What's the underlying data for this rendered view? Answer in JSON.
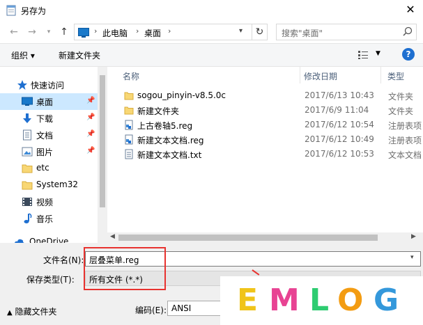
{
  "window": {
    "title": "另存为",
    "close_glyph": "✕"
  },
  "address": {
    "crumbs": [
      "此电脑",
      "桌面"
    ],
    "separator": "›"
  },
  "search": {
    "placeholder": "搜索\"桌面\""
  },
  "toolbar": {
    "organize_label": "组织 ▾",
    "new_folder_label": "新建文件夹",
    "help_label": "?"
  },
  "nav": {
    "items": [
      {
        "label": "快速访问",
        "icon": "star-icon"
      },
      {
        "label": "桌面",
        "icon": "desktop-icon",
        "selected": true,
        "pinned": true
      },
      {
        "label": "下载",
        "icon": "download-icon",
        "pinned": true
      },
      {
        "label": "文档",
        "icon": "document-icon",
        "pinned": true
      },
      {
        "label": "图片",
        "icon": "picture-icon",
        "pinned": true
      },
      {
        "label": "etc",
        "icon": "folder-icon"
      },
      {
        "label": "System32",
        "icon": "folder-icon"
      },
      {
        "label": "视频",
        "icon": "video-icon"
      },
      {
        "label": "音乐",
        "icon": "music-icon"
      },
      {
        "label": "OneDrive",
        "icon": "cloud-icon"
      }
    ]
  },
  "columns": {
    "name": "名称",
    "modified": "修改日期",
    "type": "类型"
  },
  "files": [
    {
      "name": "sogou_pinyin-v8.5.0c",
      "modified": "2017/6/13 10:43",
      "type": "文件夹",
      "icon": "folder-icon"
    },
    {
      "name": "新建文件夹",
      "modified": "2017/6/9 11:04",
      "type": "文件夹",
      "icon": "folder-icon"
    },
    {
      "name": "上古卷轴5.reg",
      "modified": "2017/6/12 10:54",
      "type": "注册表项",
      "icon": "registry-file-icon"
    },
    {
      "name": "新建文本文档.reg",
      "modified": "2017/6/12 10:49",
      "type": "注册表项",
      "icon": "registry-file-icon"
    },
    {
      "name": "新建文本文档.txt",
      "modified": "2017/6/12 10:53",
      "type": "文本文档",
      "icon": "text-file-icon"
    }
  ],
  "form": {
    "filename_label": "文件名(N):",
    "filename_value": "层叠菜单.reg",
    "savetype_label": "保存类型(T):",
    "savetype_value": "所有文件 (*.*)",
    "hide_folders_label": "隐藏文件夹",
    "encoding_label": "编码(E):",
    "encoding_value": "ANSI"
  },
  "watermark": {
    "letters": [
      "E",
      "M",
      "L",
      "O",
      "G"
    ],
    "colors": [
      "#f0c419",
      "#e84393",
      "#2ecc71",
      "#f39c12",
      "#3498db"
    ]
  },
  "colors": {
    "selection": "#cce8ff",
    "highlight_box": "#e8322f",
    "accent": "#1e6fd0"
  }
}
